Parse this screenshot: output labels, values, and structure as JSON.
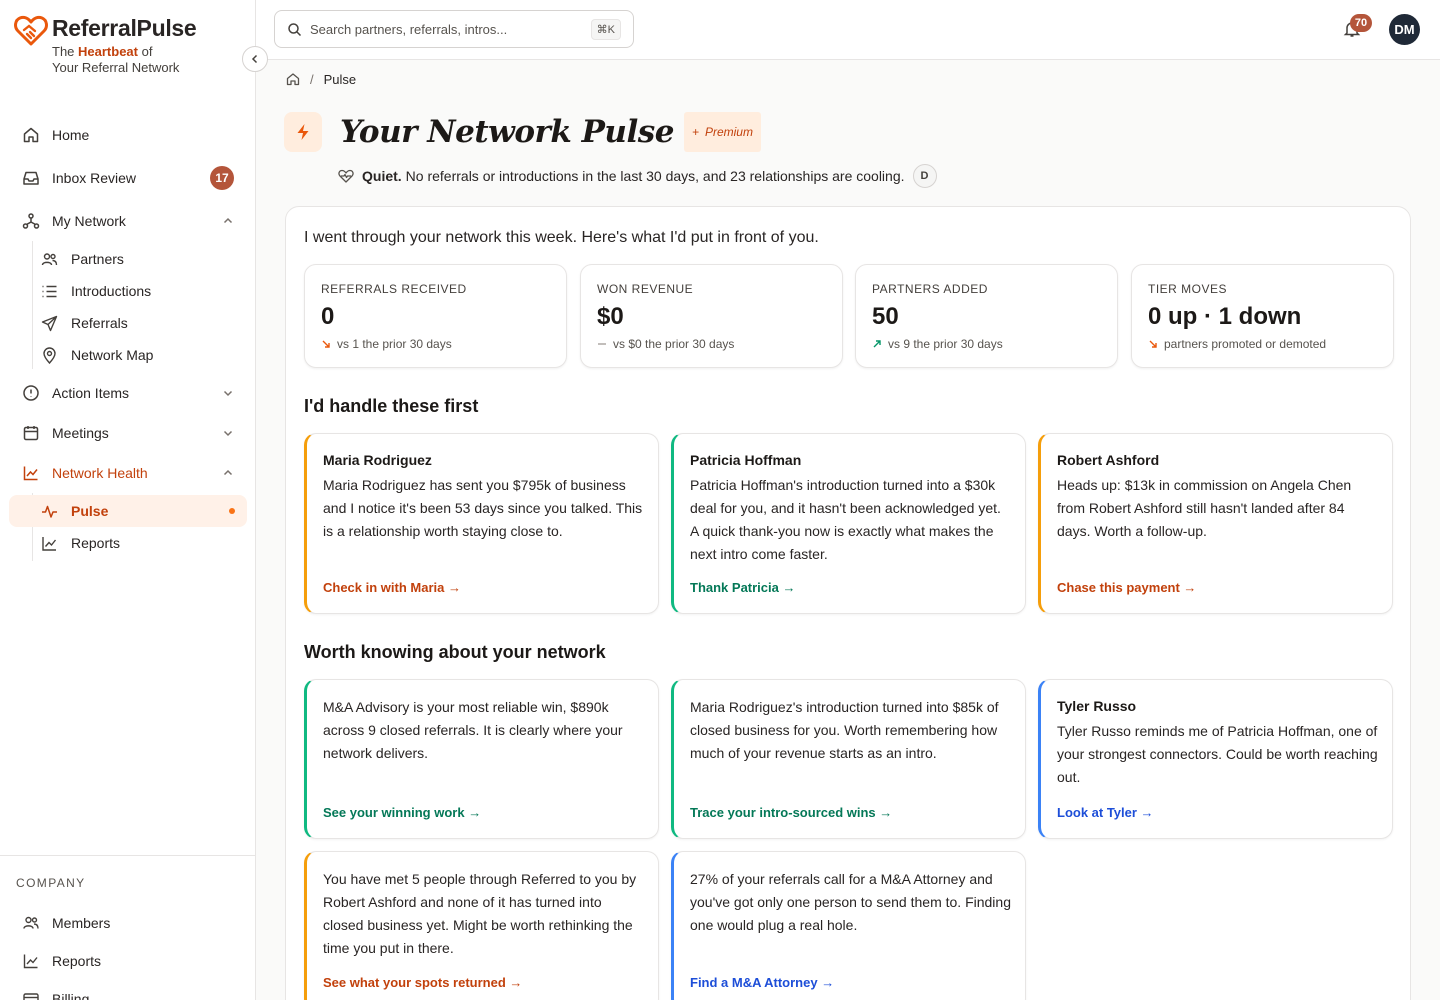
{
  "brand": {
    "name": "ReferralPulse",
    "tag_prefix": "The ",
    "tag_highlight": "Heartbeat",
    "tag_suffix": " of",
    "tag_line2": "Your Referral Network"
  },
  "sidebar": {
    "items": [
      {
        "label": "Home"
      },
      {
        "label": "Inbox Review",
        "badge": "17"
      },
      {
        "label": "My Network"
      },
      {
        "label": "Action Items"
      },
      {
        "label": "Meetings"
      },
      {
        "label": "Network Health"
      }
    ],
    "network_sub": [
      {
        "label": "Partners"
      },
      {
        "label": "Introductions"
      },
      {
        "label": "Referrals"
      },
      {
        "label": "Network Map"
      }
    ],
    "health_sub": [
      {
        "label": "Pulse"
      },
      {
        "label": "Reports"
      }
    ],
    "company_label": "COMPANY",
    "company_items": [
      {
        "label": "Members"
      },
      {
        "label": "Reports"
      },
      {
        "label": "Billing"
      }
    ]
  },
  "topbar": {
    "search_placeholder": "Search partners, referrals, intros...",
    "shortcut": "⌘K",
    "notification_count": "70",
    "avatar_initials": "DM"
  },
  "breadcrumb": {
    "current": "Pulse",
    "separator": "/"
  },
  "page": {
    "title": "Your Network Pulse",
    "premium_label": "Premium",
    "status_strong": "Quiet.",
    "status_text": "No referrals or introductions in the last 30 days, and 23 relationships are cooling.",
    "status_chip": "D",
    "intro": "I went through your network this week. Here's what I'd put in front of you."
  },
  "stats": [
    {
      "label": "REFERRALS RECEIVED",
      "value": "0",
      "sub": "vs 1 the prior 30 days",
      "trend": "down"
    },
    {
      "label": "WON REVENUE",
      "value": "$0",
      "sub": "vs $0 the prior 30 days",
      "trend": "flat"
    },
    {
      "label": "PARTNERS ADDED",
      "value": "50",
      "sub": "vs 9 the prior 30 days",
      "trend": "up"
    },
    {
      "label": "TIER MOVES",
      "value": "0 up · 1 down",
      "sub": "partners promoted or demoted",
      "trend": "down"
    }
  ],
  "sections": {
    "first": "I'd handle these first",
    "second": "Worth knowing about your network"
  },
  "priority_cards": [
    {
      "name": "Maria Rodriguez",
      "body": "Maria Rodriguez has sent you $795k of business and I notice it's been 53 days since you talked. This is a relationship worth staying close to.",
      "link": "Check in with Maria →"
    },
    {
      "name": "Patricia Hoffman",
      "body": "Patricia Hoffman's introduction turned into a $30k deal for you, and it hasn't been acknowledged yet. A quick thank-you now is exactly what makes the next intro come faster.",
      "link": "Thank Patricia →"
    },
    {
      "name": "Robert Ashford",
      "body": "Heads up: $13k in commission on Angela Chen from Robert Ashford still hasn't landed after 84 days. Worth a follow-up.",
      "link": "Chase this payment →"
    }
  ],
  "insight_cards": [
    {
      "body": "M&A Advisory is your most reliable win, $890k across 9 closed referrals. It is clearly where your network delivers.",
      "link": "See your winning work →"
    },
    {
      "body": "Maria Rodriguez's introduction turned into $85k of closed business for you. Worth remembering how much of your revenue starts as an intro.",
      "link": "Trace your intro-sourced wins →"
    },
    {
      "name": "Tyler Russo",
      "body": "Tyler Russo reminds me of Patricia Hoffman, one of your strongest connectors. Could be worth reaching out.",
      "link": "Look at Tyler →"
    },
    {
      "body": "You have met 5 people through Referred to you by Robert Ashford and none of it has turned into closed business yet. Might be worth rethinking the time you put in there.",
      "link": "See what your spots returned →"
    },
    {
      "body": "27% of your referrals call for a M&A Attorney and you've got only one person to send them to. Finding one would plug a real hole.",
      "link": "Find a M&A Attorney →"
    }
  ],
  "colors": {
    "accent": "#c2410c",
    "badge": "#b4553a",
    "card_orange": "#f59e0b",
    "card_green": "#10b981",
    "card_blue": "#3b82f6"
  }
}
